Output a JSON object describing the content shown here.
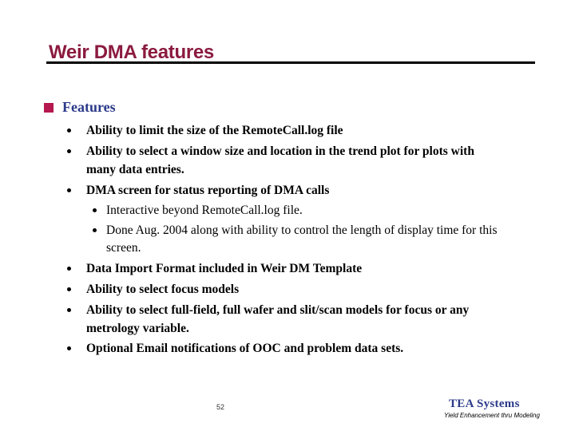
{
  "slide": {
    "title": "Weir DMA features",
    "section_heading": "Features",
    "bullets": [
      "Ability to limit the size of the RemoteCall.log file",
      "Ability to select a window size and location in the trend plot for plots with",
      "many data entries.",
      "DMA screen for status reporting of DMA calls",
      "Data Import Format included in Weir DM Template",
      "Ability to select focus models",
      "Ability to select full-field, full wafer and slit/scan models for focus or any",
      "metrology variable.",
      "Optional Email notifications of OOC and problem data sets."
    ],
    "sub_bullets": [
      "Interactive beyond RemoteCall.log file.",
      "Done Aug. 2004 along with ability to control the length of display time for this",
      "screen."
    ],
    "page_number": "52",
    "brand": "TEA Systems",
    "tagline": "Yield Enhancement thru Modeling"
  }
}
